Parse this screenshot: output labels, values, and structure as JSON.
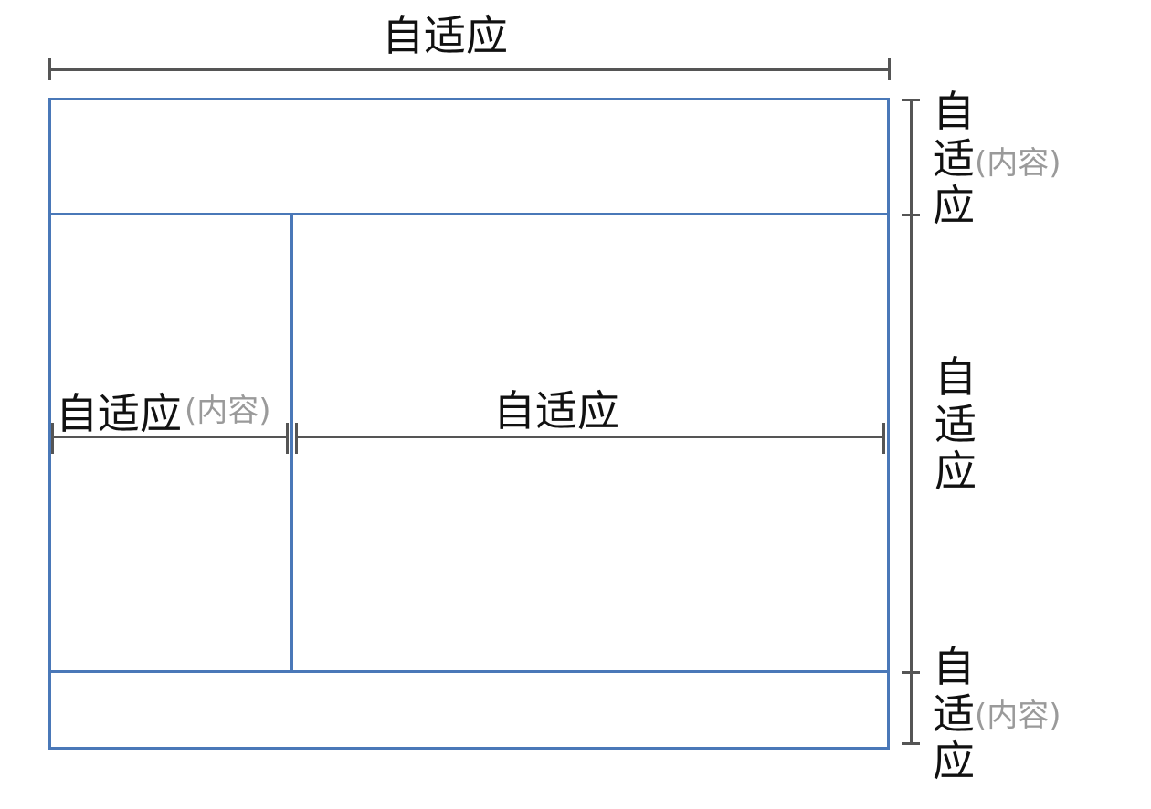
{
  "layout_diagram": {
    "top_label": "自适应",
    "left_label": "自适应",
    "left_note": "(内容)",
    "center_label": "自适应",
    "right_top_label": "自适应",
    "right_top_note": "(内容)",
    "right_middle_label": "自适应",
    "right_bottom_label": "自适应",
    "right_bottom_note": "(内容)"
  },
  "colors": {
    "box_border": "#4a78b8",
    "dimension_line": "#555555",
    "note_text": "#9a9a9a"
  }
}
